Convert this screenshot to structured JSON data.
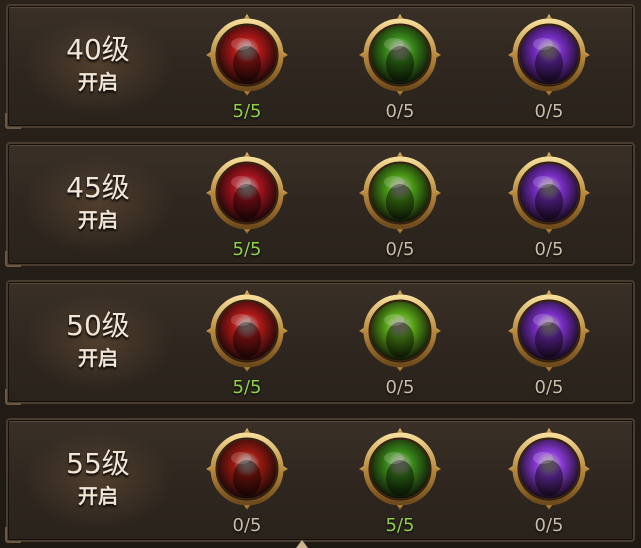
{
  "rows": [
    {
      "level": "40级",
      "open": "开启",
      "skills": [
        {
          "icon": "red-hex-shell-icon",
          "count": "5/5",
          "color": "#b01818"
        },
        {
          "icon": "green-demon-wings-icon",
          "count": "0/5",
          "color": "#3a8a1a"
        },
        {
          "icon": "purple-shadow-strike-icon",
          "count": "0/5",
          "color": "#7a2fc8"
        }
      ]
    },
    {
      "level": "45级",
      "open": "开启",
      "skills": [
        {
          "icon": "red-bat-wing-icon",
          "count": "5/5",
          "color": "#a8141e"
        },
        {
          "icon": "green-demon-lord-icon",
          "count": "0/5",
          "color": "#4a9a16"
        },
        {
          "icon": "purple-shadow-figure-icon",
          "count": "0/5",
          "color": "#7a2fc8"
        }
      ]
    },
    {
      "level": "50级",
      "open": "开启",
      "skills": [
        {
          "icon": "red-rune-glyph-icon",
          "count": "5/5",
          "color": "#b01818"
        },
        {
          "icon": "green-spirit-burst-icon",
          "count": "0/5",
          "color": "#5aa818"
        },
        {
          "icon": "purple-dash-strike-icon",
          "count": "0/5",
          "color": "#7a2fc8"
        }
      ]
    },
    {
      "level": "55级",
      "open": "开启",
      "skills": [
        {
          "icon": "red-horned-demon-icon",
          "count": "0/5",
          "color": "#9a1a10"
        },
        {
          "icon": "green-horned-beast-icon",
          "count": "5/5",
          "color": "#3a8a1a"
        },
        {
          "icon": "purple-grinning-imp-icon",
          "count": "0/5",
          "color": "#8a3ad8"
        }
      ]
    }
  ]
}
